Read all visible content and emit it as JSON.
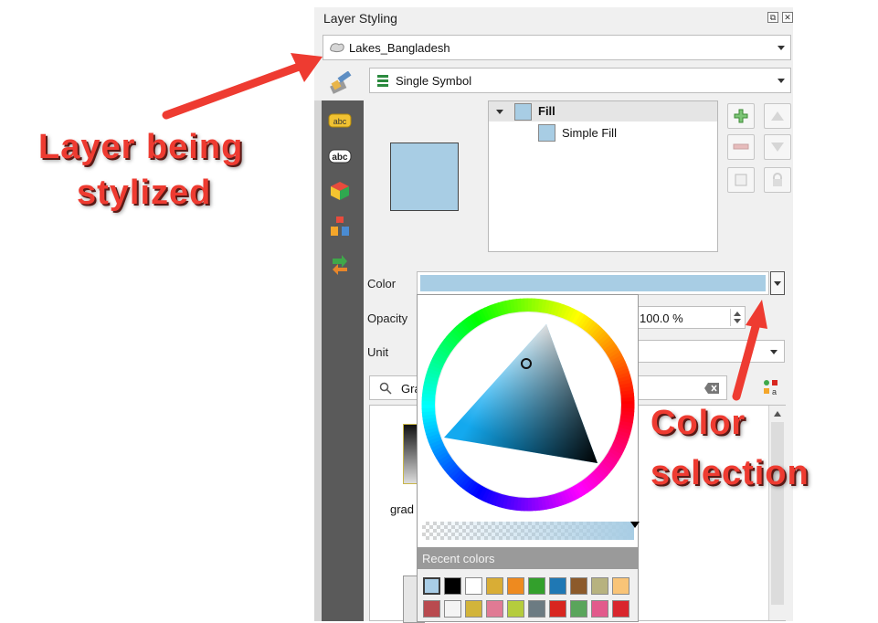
{
  "panel": {
    "title": "Layer Styling",
    "layer_name": "Lakes_Bangladesh",
    "renderer": "Single Symbol"
  },
  "symbol_tree": {
    "root_label": "Fill",
    "child_label": "Simple Fill"
  },
  "form": {
    "color_label": "Color",
    "opacity_label": "Opacity",
    "opacity_value": "100.0 %",
    "unit_label": "Unit",
    "search_value": "Gra",
    "gradient_item_label": "grad"
  },
  "color_picker": {
    "recent_colors_label": "Recent colors",
    "recent_colors_row1": [
      "#a9cde6",
      "#000000",
      "#ffffff",
      "#d9ad35",
      "#ee8a1f",
      "#33a02c",
      "#1f78b4",
      "#8c5a2b",
      "#b7b27f",
      "#f9c477"
    ],
    "recent_colors_row2": [
      "#b94a4f",
      "#f4f4f4",
      "#d2b43a",
      "#e07a94",
      "#b5cc3d",
      "#6c7b82",
      "#d8261f",
      "#5aa55b",
      "#e25a8c",
      "#d9262d"
    ]
  },
  "colors": {
    "fill_color": "#a8cde4",
    "callout_red": "#ee3b31"
  },
  "annotations": {
    "layer_line1": "Layer being",
    "layer_line2": "stylized",
    "color_line1": "Color",
    "color_line2": "selection"
  }
}
